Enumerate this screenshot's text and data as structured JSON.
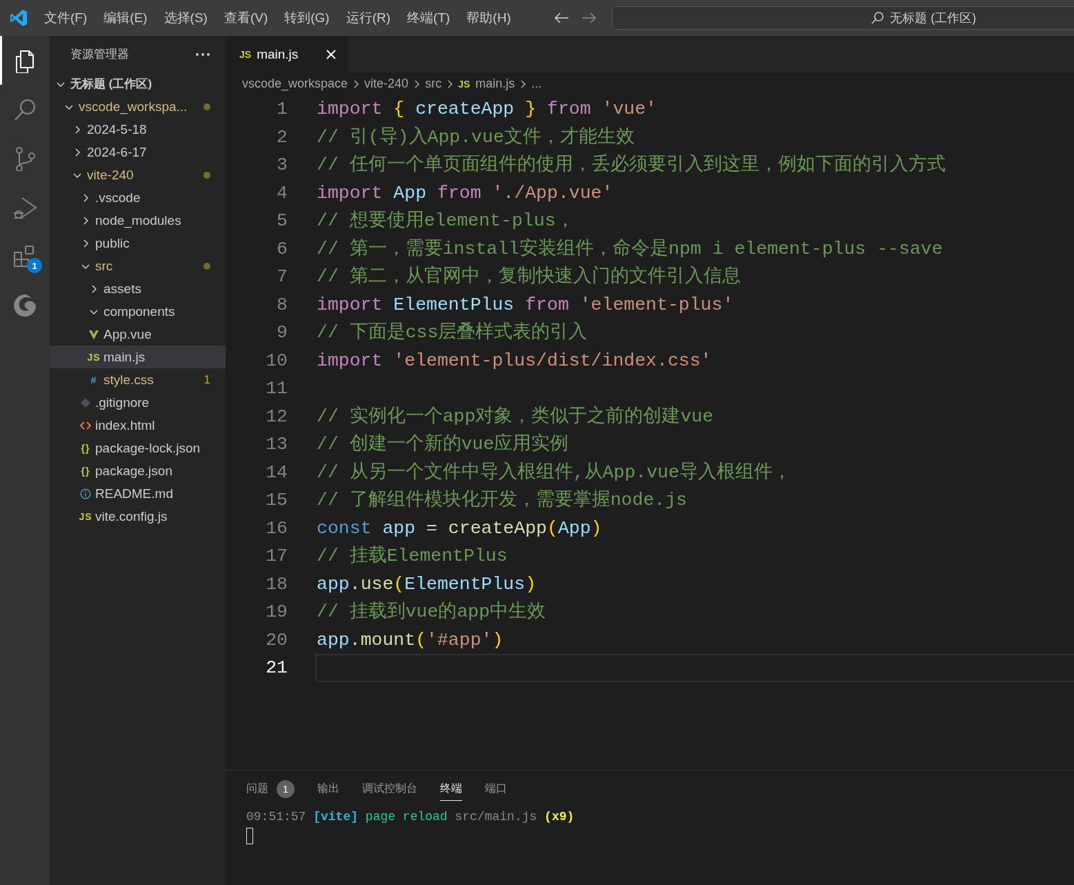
{
  "title_bar": {
    "menu": [
      "文件(F)",
      "编辑(E)",
      "选择(S)",
      "查看(V)",
      "转到(G)",
      "运行(R)",
      "终端(T)",
      "帮助(H)"
    ],
    "search": {
      "placeholder": "无标题 (工作区)"
    }
  },
  "activity_bar": [
    {
      "kind": "explorer",
      "selected": true
    },
    {
      "kind": "search",
      "selected": false
    },
    {
      "kind": "source-control",
      "selected": false
    },
    {
      "kind": "run-debug",
      "selected": false
    },
    {
      "kind": "extensions",
      "selected": false,
      "badge": "1"
    },
    {
      "kind": "swirl",
      "selected": false
    }
  ],
  "sidebar": {
    "title": "资源管理器",
    "tree": [
      {
        "label": "无标题 (工作区)",
        "kind": "root",
        "expanded": true,
        "selected": false,
        "modified": false,
        "children": [
          {
            "label": "vscode_workspa...",
            "kind": "folder",
            "expanded": true,
            "selected": false,
            "modified": true,
            "children": [
              {
                "label": "2024-5-18",
                "kind": "folder",
                "expanded": false,
                "selected": false,
                "modified": false
              },
              {
                "label": "2024-6-17",
                "kind": "folder",
                "expanded": false,
                "selected": false,
                "modified": false
              },
              {
                "label": "vite-240",
                "kind": "folder",
                "expanded": true,
                "selected": false,
                "modified": true,
                "children": [
                  {
                    "label": ".vscode",
                    "kind": "folder",
                    "expanded": false,
                    "selected": false,
                    "modified": false
                  },
                  {
                    "label": "node_modules",
                    "kind": "folder",
                    "expanded": false,
                    "selected": false,
                    "modified": false
                  },
                  {
                    "label": "public",
                    "kind": "folder",
                    "expanded": false,
                    "selected": false,
                    "modified": false
                  },
                  {
                    "label": "src",
                    "kind": "folder",
                    "expanded": true,
                    "selected": false,
                    "modified": true,
                    "children": [
                      {
                        "label": "assets",
                        "kind": "folder",
                        "expanded": false,
                        "selected": false,
                        "modified": false
                      },
                      {
                        "label": "components",
                        "kind": "folder",
                        "expanded": true,
                        "selected": false,
                        "modified": false
                      },
                      {
                        "label": "App.vue",
                        "kind": "vue",
                        "selected": false,
                        "modified": false
                      },
                      {
                        "label": "main.js",
                        "kind": "js",
                        "icon_text": "JS",
                        "selected": true,
                        "modified": false
                      },
                      {
                        "label": "style.css",
                        "kind": "css",
                        "icon_text": "#",
                        "selected": false,
                        "modified": true,
                        "problems": "1"
                      }
                    ]
                  },
                  {
                    "label": ".gitignore",
                    "kind": "git",
                    "selected": false,
                    "modified": false
                  },
                  {
                    "label": "index.html",
                    "kind": "html",
                    "selected": false,
                    "modified": false
                  },
                  {
                    "label": "package-lock.json",
                    "kind": "json",
                    "icon_text": "{}",
                    "selected": false,
                    "modified": false
                  },
                  {
                    "label": "package.json",
                    "kind": "json",
                    "icon_text": "{}",
                    "selected": false,
                    "modified": false
                  },
                  {
                    "label": "README.md",
                    "kind": "info",
                    "selected": false,
                    "modified": false
                  },
                  {
                    "label": "vite.config.js",
                    "kind": "js",
                    "icon_text": "JS",
                    "selected": false,
                    "modified": false
                  }
                ]
              }
            ]
          }
        ]
      }
    ]
  },
  "editor": {
    "tabs": [
      {
        "label": "main.js",
        "icon_text": "JS",
        "selected": true
      }
    ],
    "breadcrumb": [
      {
        "label": "vscode_workspace"
      },
      {
        "label": "vite-240"
      },
      {
        "label": "src"
      },
      {
        "label": "main.js",
        "icon_text": "JS"
      },
      {
        "label": "..."
      }
    ],
    "lines": [
      {
        "number": "1",
        "current": false,
        "tokens": [
          {
            "text": "import ",
            "kind": "kw"
          },
          {
            "text": "{ ",
            "kind": "br"
          },
          {
            "text": "createApp",
            "kind": "var"
          },
          {
            "text": " }",
            "kind": "br"
          },
          {
            "text": " from ",
            "kind": "kw"
          },
          {
            "text": "'vue'",
            "kind": "str"
          }
        ]
      },
      {
        "number": "2",
        "current": false,
        "tokens": [
          {
            "text": "// 引(导)入App.vue文件，才能生效",
            "kind": "com"
          }
        ]
      },
      {
        "number": "3",
        "current": false,
        "tokens": [
          {
            "text": "// 任何一个单页面组件的使用，丢必须要引入到这里，例如下面的引入方式",
            "kind": "com"
          }
        ]
      },
      {
        "number": "4",
        "current": false,
        "tokens": [
          {
            "text": "import ",
            "kind": "kw"
          },
          {
            "text": "App",
            "kind": "var"
          },
          {
            "text": " from ",
            "kind": "kw"
          },
          {
            "text": "'./App.vue'",
            "kind": "str"
          }
        ]
      },
      {
        "number": "5",
        "current": false,
        "tokens": [
          {
            "text": "// 想要使用element-plus，",
            "kind": "com"
          }
        ]
      },
      {
        "number": "6",
        "current": false,
        "tokens": [
          {
            "text": "// 第一，需要install安装组件，命令是npm i element-plus --save",
            "kind": "com"
          }
        ]
      },
      {
        "number": "7",
        "current": false,
        "tokens": [
          {
            "text": "// 第二，从官网中，复制快速入门的文件引入信息",
            "kind": "com"
          }
        ]
      },
      {
        "number": "8",
        "current": false,
        "tokens": [
          {
            "text": "import ",
            "kind": "kw"
          },
          {
            "text": "ElementPlus",
            "kind": "var"
          },
          {
            "text": " from ",
            "kind": "kw"
          },
          {
            "text": "'element-plus'",
            "kind": "str"
          }
        ]
      },
      {
        "number": "9",
        "current": false,
        "tokens": [
          {
            "text": "// 下面是css层叠样式表的引入",
            "kind": "com"
          }
        ]
      },
      {
        "number": "10",
        "current": false,
        "tokens": [
          {
            "text": "import ",
            "kind": "kw"
          },
          {
            "text": "'element-plus/dist/index.css'",
            "kind": "str"
          }
        ]
      },
      {
        "number": "11",
        "current": false
      },
      {
        "number": "12",
        "current": false,
        "tokens": [
          {
            "text": "// 实例化一个app对象，类似于之前的创建vue",
            "kind": "com"
          }
        ]
      },
      {
        "number": "13",
        "current": false,
        "tokens": [
          {
            "text": "// 创建一个新的vue应用实例",
            "kind": "com"
          }
        ]
      },
      {
        "number": "14",
        "current": false,
        "tokens": [
          {
            "text": "// 从另一个文件中导入根组件,从App.vue导入根组件，",
            "kind": "com"
          }
        ]
      },
      {
        "number": "15",
        "current": false,
        "tokens": [
          {
            "text": "// 了解组件模块化开发，需要掌握node.js",
            "kind": "com"
          }
        ]
      },
      {
        "number": "16",
        "current": false,
        "tokens": [
          {
            "text": "const ",
            "kind": "decl"
          },
          {
            "text": "app",
            "kind": "var"
          },
          {
            "text": " = ",
            "kind": "pl"
          },
          {
            "text": "createApp",
            "kind": "fn"
          },
          {
            "text": "(",
            "kind": "br"
          },
          {
            "text": "App",
            "kind": "var"
          },
          {
            "text": ")",
            "kind": "br"
          }
        ]
      },
      {
        "number": "17",
        "current": false,
        "tokens": [
          {
            "text": "// 挂载ElementPlus",
            "kind": "com"
          }
        ]
      },
      {
        "number": "18",
        "current": false,
        "tokens": [
          {
            "text": "app",
            "kind": "var"
          },
          {
            "text": ".",
            "kind": "pl"
          },
          {
            "text": "use",
            "kind": "fn"
          },
          {
            "text": "(",
            "kind": "br"
          },
          {
            "text": "ElementPlus",
            "kind": "var"
          },
          {
            "text": ")",
            "kind": "br"
          }
        ]
      },
      {
        "number": "19",
        "current": false,
        "tokens": [
          {
            "text": "// 挂载到vue的app中生效",
            "kind": "com"
          }
        ]
      },
      {
        "number": "20",
        "current": false,
        "tokens": [
          {
            "text": "app",
            "kind": "var"
          },
          {
            "text": ".",
            "kind": "pl"
          },
          {
            "text": "mount",
            "kind": "fn"
          },
          {
            "text": "(",
            "kind": "br"
          },
          {
            "text": "'#app'",
            "kind": "str"
          },
          {
            "text": ")",
            "kind": "br"
          }
        ]
      },
      {
        "number": "21",
        "current": true
      }
    ]
  },
  "panel": {
    "tabs": [
      {
        "label": "问题",
        "badge": "1",
        "selected": false
      },
      {
        "label": "输出",
        "selected": false
      },
      {
        "label": "调试控制台",
        "selected": false
      },
      {
        "label": "终端",
        "selected": true
      },
      {
        "label": "端口",
        "selected": false
      }
    ],
    "terminal": [
      {
        "text": "09:51:57 ",
        "kind": "time"
      },
      {
        "text": "[vite]",
        "kind": "tag"
      },
      {
        "text": " page reload ",
        "kind": "msg"
      },
      {
        "text": "src/main.js ",
        "kind": "path"
      },
      {
        "text": "(x9)",
        "kind": "count"
      }
    ]
  }
}
